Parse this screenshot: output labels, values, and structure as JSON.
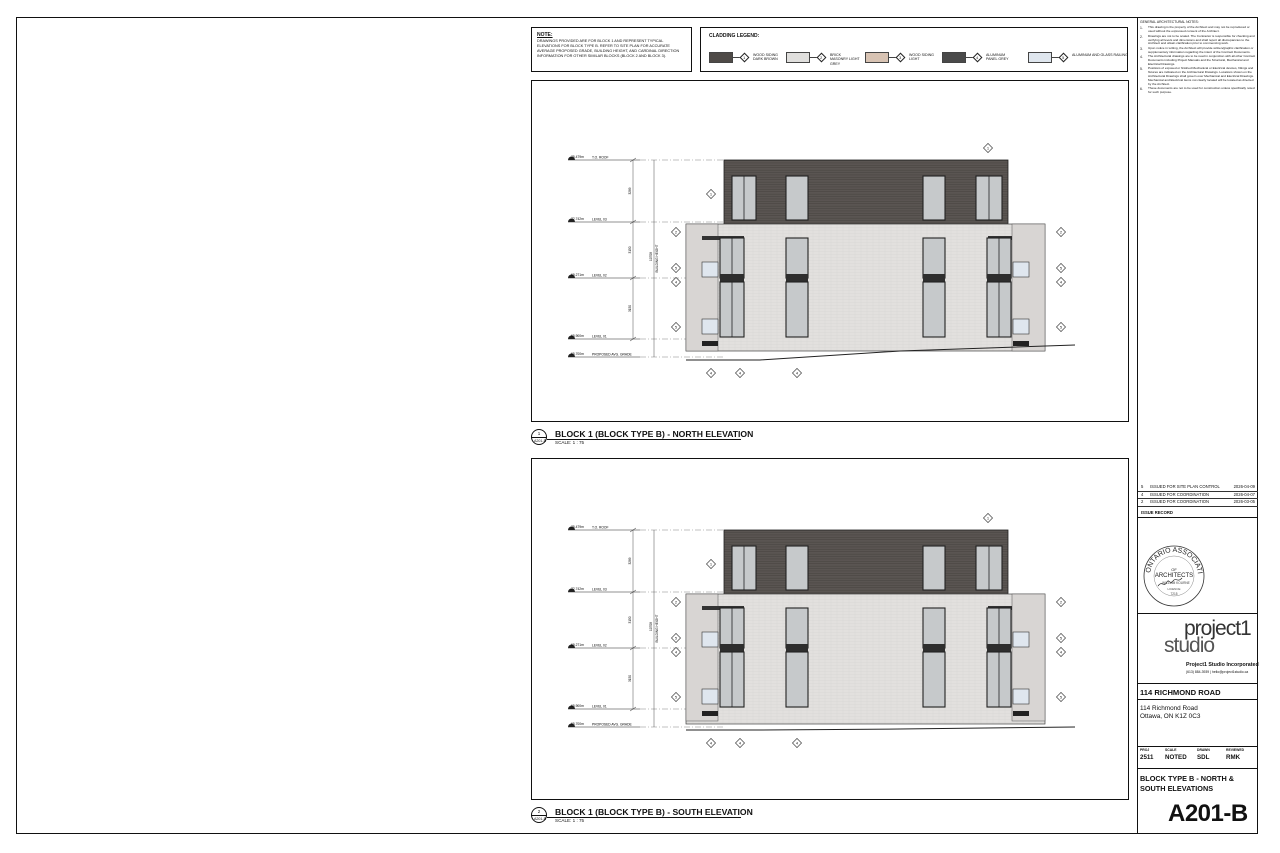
{
  "note": {
    "title": "NOTE:",
    "body": "DRAWINGS PROVIDED ARE FOR BLOCK 1 AND REPRESENT TYPICAL ELEVATIONS FOR BLOCK TYPE B. REFER TO SITE PLAN FOR ACCURATE AVERAGE PROPOSED GRADE, BUILDING HEIGHT, AND CARDINAL DIRECTION INFORMATION FOR OTHER SIMILAR BLOCKS (BLOCK 2 AND BLOCK 3)."
  },
  "legend": {
    "title": "CLADDING LEGEND:",
    "items": [
      {
        "num": "1",
        "label": "WOOD SIDING DARK BROWN",
        "color": "#4e4a47"
      },
      {
        "num": "2",
        "label": "BRICK MASONRY LIGHT GREY",
        "color": "#e0dfdd"
      },
      {
        "num": "3",
        "label": "WOOD SIDING LIGHT",
        "color": "#d8c3b3"
      },
      {
        "num": "4",
        "label": "ALUMINUM PANEL GREY",
        "color": "#4a4a4a"
      },
      {
        "num": "5",
        "label": "ALUMINUM AND GLASS RAILING",
        "color": "#dfe6ee"
      }
    ]
  },
  "general_notes": {
    "title": "GENERAL ARCHITECTURAL NOTES:",
    "items": [
      {
        "num": "1.",
        "text": "This drawing is the property of the Architect and may not be reproduced or used without the expressed consent of the Architect."
      },
      {
        "num": "2.",
        "text": "Drawings are not to be scaled. The Contractor is responsible for checking and verifying all levels and dimensions and shall report all discrepancies to the Architect and obtain clarification prior to commencing work."
      },
      {
        "num": "3.",
        "text": "Upon notice in writing, the Architect will provide written/graphic clarification or supplementary information regarding the intent of the Contract Documents."
      },
      {
        "num": "4.",
        "text": "The Architectural drawings are to be read in conjunction with all other Contract Documents including Project Manuals and the Structural, Mechanical and Electrical Drawings."
      },
      {
        "num": "5.",
        "text": "Positions of exposed or finished Mechanical or Electrical devices, fittings and fixtures are indicated on the Architectural Drawings. Locations shown on the Architectural Drawings shall govern over Mechanical and Electrical Drawings. Mechanical and Electrical items not clearly located will be located as directed by the Architect."
      },
      {
        "num": "6.",
        "text": "These documents are not to be used for construction unless specifically noted for such purpose."
      }
    ]
  },
  "issue_record": {
    "title": "ISSUE RECORD",
    "rows": [
      {
        "num": "5",
        "desc": "ISSUED FOR SITE PLAN CONTROL",
        "date": "2026-04-09"
      },
      {
        "num": "4",
        "desc": "ISSUED FOR COORDINATION",
        "date": "2026-04-07"
      },
      {
        "num": "2",
        "desc": "ISSUED FOR COORDINATION",
        "date": "2026-03-05"
      }
    ]
  },
  "seal": {
    "lines": [
      "ONTARIO ASSOCIATION",
      "OF",
      "ARCHITECTS",
      "WILLIAM KOURNE",
      "LICENCE",
      "7215"
    ]
  },
  "firm": {
    "logo_line1": "project1",
    "logo_line2": "studio",
    "name": "Project1 Studio Incorporated",
    "contact": "(613) 884-3939 | hello@project1studio.ca"
  },
  "project": {
    "name": "114 RICHMOND ROAD",
    "address_line1": "114 Richmond Road",
    "address_line2": "Ottawa, ON K1Z 0C3"
  },
  "info": {
    "proj_label": "PROJ",
    "proj": "2511",
    "scale_label": "SCALE",
    "scale": "NOTED",
    "drawn_label": "DRAWN",
    "drawn": "SDL",
    "reviewed_label": "REVIEWED",
    "reviewed": "RMK"
  },
  "sheet": {
    "title": "BLOCK TYPE B - NORTH & SOUTH ELEVATIONS",
    "number": "A201-B"
  },
  "views": [
    {
      "num": "1",
      "ref": "A201-B",
      "title": "BLOCK 1 (BLOCK TYPE B) - NORTH ELEVATION",
      "scale": "SCALE: 1 : 75"
    },
    {
      "num": "2",
      "ref": "A201-B",
      "title": "BLOCK 1 (BLOCK TYPE B) - SOUTH ELEVATION",
      "scale": "SCALE: 1 : 75"
    }
  ],
  "levels": [
    {
      "elev": "75.479m",
      "name": "T.O. ROOF"
    },
    {
      "elev": "72.742m",
      "name": "LEVEL 03"
    },
    {
      "elev": "69.271m",
      "name": "LEVEL 02"
    },
    {
      "elev": "65.900m",
      "name": "LEVEL 01"
    },
    {
      "elev": "65.700m",
      "name": "PROPOSED AVG. GRADE"
    }
  ],
  "dims": {
    "d1": "3289",
    "d2": "3150",
    "d3": "3150",
    "total": "10708",
    "total_label": "BUILDING HEIGHT"
  }
}
